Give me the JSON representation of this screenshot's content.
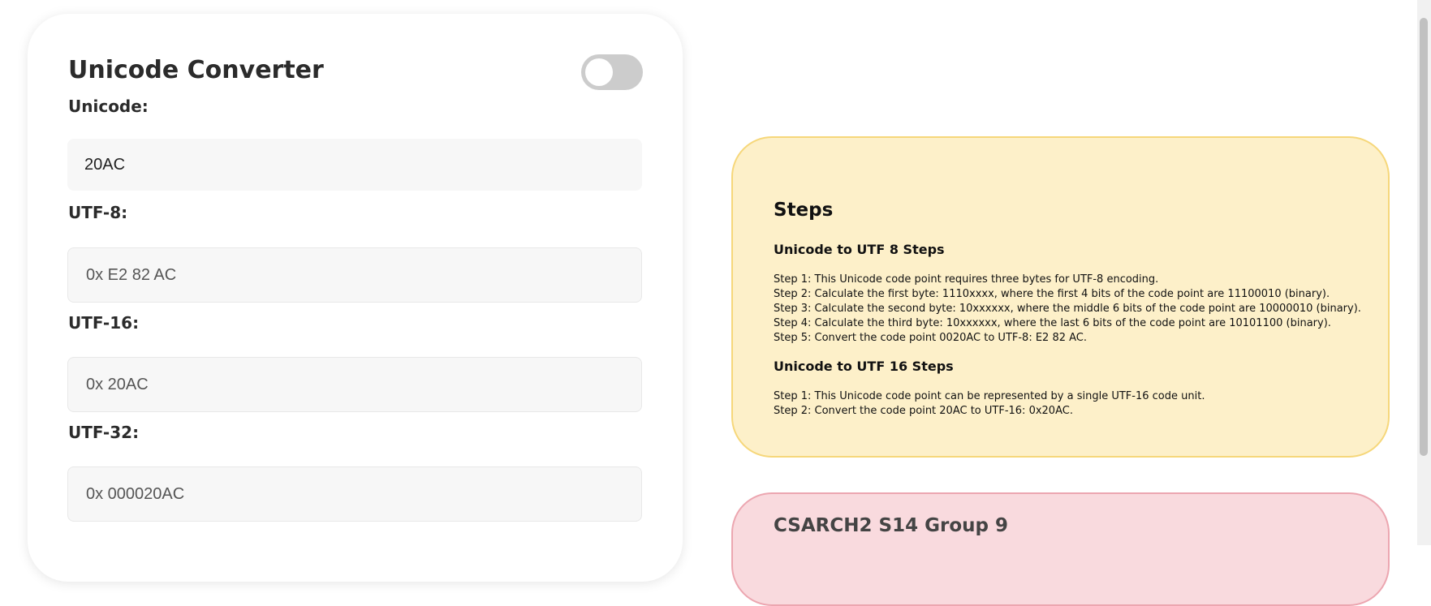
{
  "converter": {
    "title": "Unicode Converter",
    "toggle_on": false,
    "fields": {
      "unicode": {
        "label": "Unicode:",
        "value": "20AC"
      },
      "utf8": {
        "label": "UTF-8:",
        "value": "0x E2 82 AC"
      },
      "utf16": {
        "label": "UTF-16:",
        "value": "0x 20AC"
      },
      "utf32": {
        "label": "UTF-32:",
        "value": "0x 000020AC"
      }
    }
  },
  "steps": {
    "title": "Steps",
    "utf8": {
      "heading": "Unicode to UTF 8 Steps",
      "lines": [
        "Step 1: This Unicode code point requires three bytes for UTF-8 encoding.",
        "Step 2: Calculate the first byte: 1110xxxx, where the first 4 bits of the code point are 11100010 (binary).",
        "Step 3: Calculate the second byte: 10xxxxxx, where the middle 6 bits of the code point are 10000010 (binary).",
        "Step 4: Calculate the third byte: 10xxxxxx, where the last 6 bits of the code point are 10101100 (binary).",
        "Step 5: Convert the code point 0020AC to UTF-8: E2 82 AC."
      ]
    },
    "utf16": {
      "heading": "Unicode to UTF 16 Steps",
      "lines": [
        "Step 1: This Unicode code point can be represented by a single UTF-16 code unit.",
        "Step 2: Convert the code point 20AC to UTF-16: 0x20AC."
      ]
    }
  },
  "group": {
    "title": "CSARCH2 S14 Group 9"
  },
  "colors": {
    "steps_bg": "#fdf0c9",
    "steps_border": "#f6d77a",
    "group_bg": "#f9dade",
    "group_border": "#eca6b0",
    "toggle_off": "#cccccc"
  }
}
